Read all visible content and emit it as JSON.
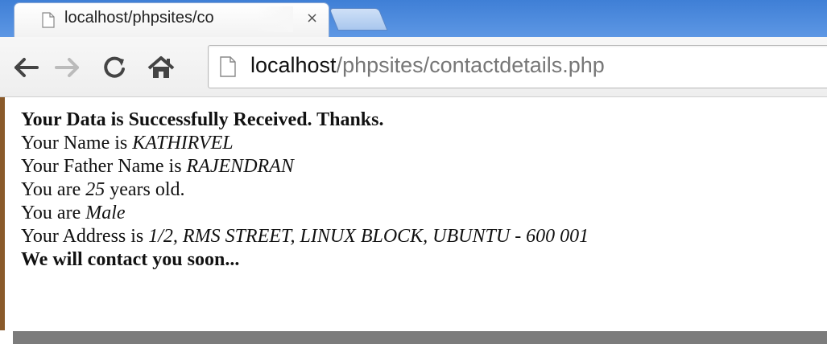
{
  "browser": {
    "tab": {
      "title": "localhost/phpsites/co",
      "close_label": "×"
    },
    "url": {
      "host": "localhost",
      "path": "/phpsites/contactdetails.php"
    }
  },
  "page": {
    "heading": "Your Data is Successfully Received. Thanks.",
    "name_label": "Your Name is",
    "name_value": "KATHIRVEL",
    "father_label": "Your Father Name is",
    "father_value": "RAJENDRAN",
    "age_prefix": "You are",
    "age_value": "25",
    "age_suffix": "years old.",
    "gender_label": "You are",
    "gender_value": "Male",
    "address_label": "Your Address is",
    "address_value": "1/2, RMS STREET, LINUX BLOCK, UBUNTU - 600 001",
    "closing": "We will contact you soon..."
  }
}
